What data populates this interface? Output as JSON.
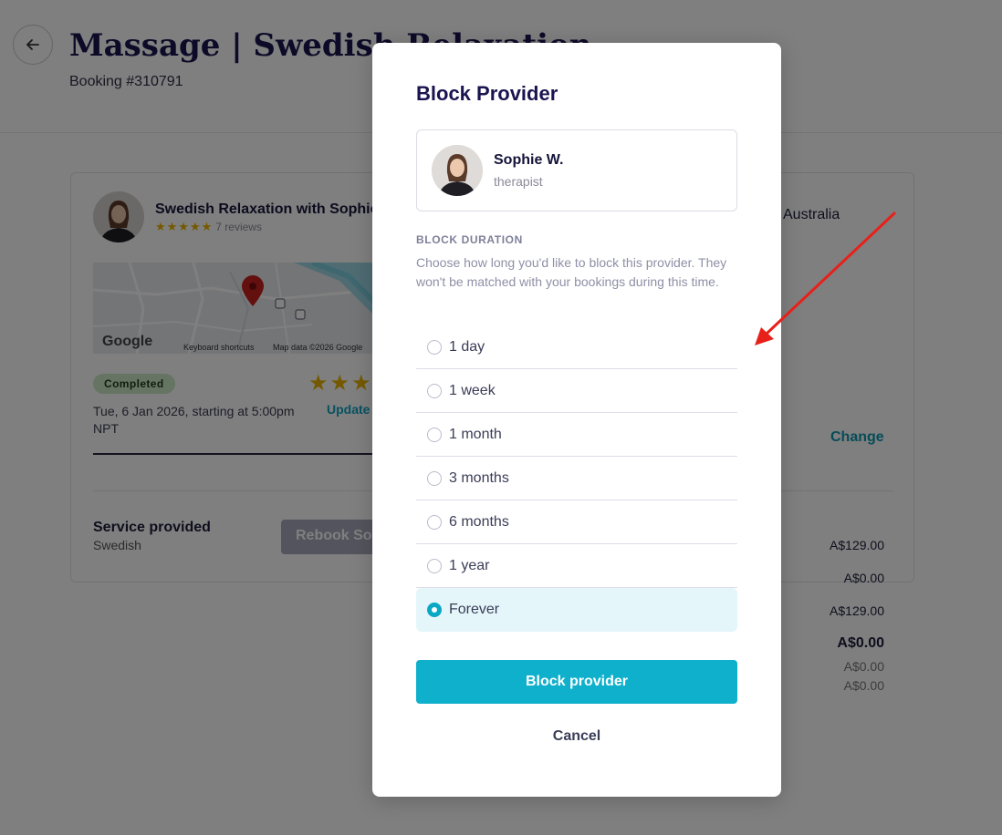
{
  "page": {
    "title": "Massage | Swedish Relaxation",
    "booking_number": "Booking #310791"
  },
  "booking_card": {
    "title": "Swedish Relaxation with Sophie",
    "stars": "★★★★★",
    "reviews": "7 reviews",
    "map": {
      "google_label": "Google",
      "shortcuts_label": "Keyboard shortcuts",
      "data_label": "Map data ©2026 Google"
    },
    "status": "Completed",
    "rating_stars": "★★★",
    "update_label": "Update",
    "date_text": "Tue, 6 Jan 2026, starting at 5:00pm NPT",
    "service_label": "Service provided",
    "service_value": "Swedish",
    "rebook_label": "Rebook Sophie",
    "location": "Australia",
    "change_label": "Change",
    "prices": [
      "A$129.00",
      "A$0.00",
      "A$129.00",
      "A$0.00",
      "A$0.00",
      "A$0.00"
    ]
  },
  "modal": {
    "title": "Block Provider",
    "provider": {
      "name": "Sophie W.",
      "role": "therapist"
    },
    "section_label": "BLOCK DURATION",
    "description": "Choose how long you'd like to block this provider. They won't be matched with your bookings during this time.",
    "options": [
      {
        "label": "1 day",
        "selected": false
      },
      {
        "label": "1 week",
        "selected": false
      },
      {
        "label": "1 month",
        "selected": false
      },
      {
        "label": "3 months",
        "selected": false
      },
      {
        "label": "6 months",
        "selected": false
      },
      {
        "label": "1 year",
        "selected": false
      },
      {
        "label": "Forever",
        "selected": true
      }
    ],
    "block_button": "Block provider",
    "cancel_button": "Cancel"
  },
  "colors": {
    "accent": "#0fb0cc",
    "title": "#1a1450",
    "annotation_arrow": "#e8201a"
  }
}
